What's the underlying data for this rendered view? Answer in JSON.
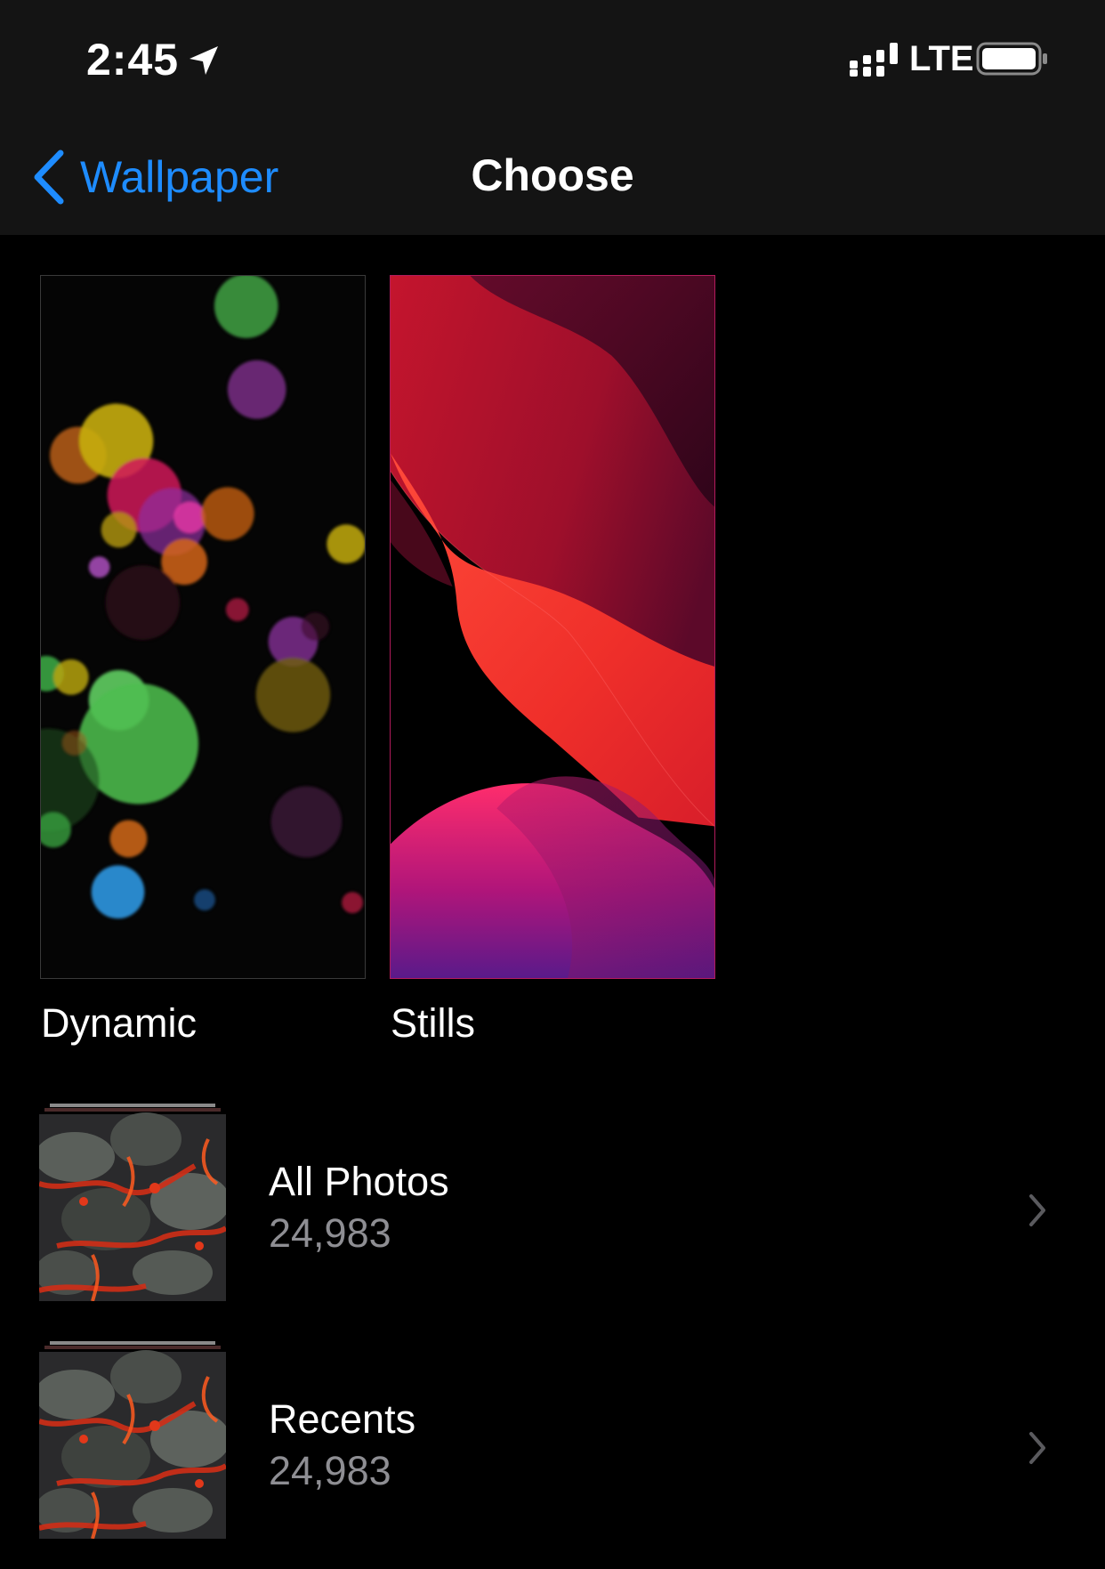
{
  "status_bar": {
    "time": "2:45",
    "network": "LTE",
    "icons": [
      "location-arrow-icon",
      "signal-bars-icon",
      "battery-icon"
    ]
  },
  "nav": {
    "back_label": "Wallpaper",
    "title": "Choose"
  },
  "tiles": [
    {
      "label": "Dynamic"
    },
    {
      "label": "Stills"
    }
  ],
  "albums": [
    {
      "name": "All Photos",
      "count": "24,983"
    },
    {
      "name": "Recents",
      "count": "24,983"
    }
  ],
  "colors": {
    "accent": "#1e8cff",
    "nav_background": "#141414",
    "background": "#000000",
    "secondary_text": "#8e8e93"
  }
}
